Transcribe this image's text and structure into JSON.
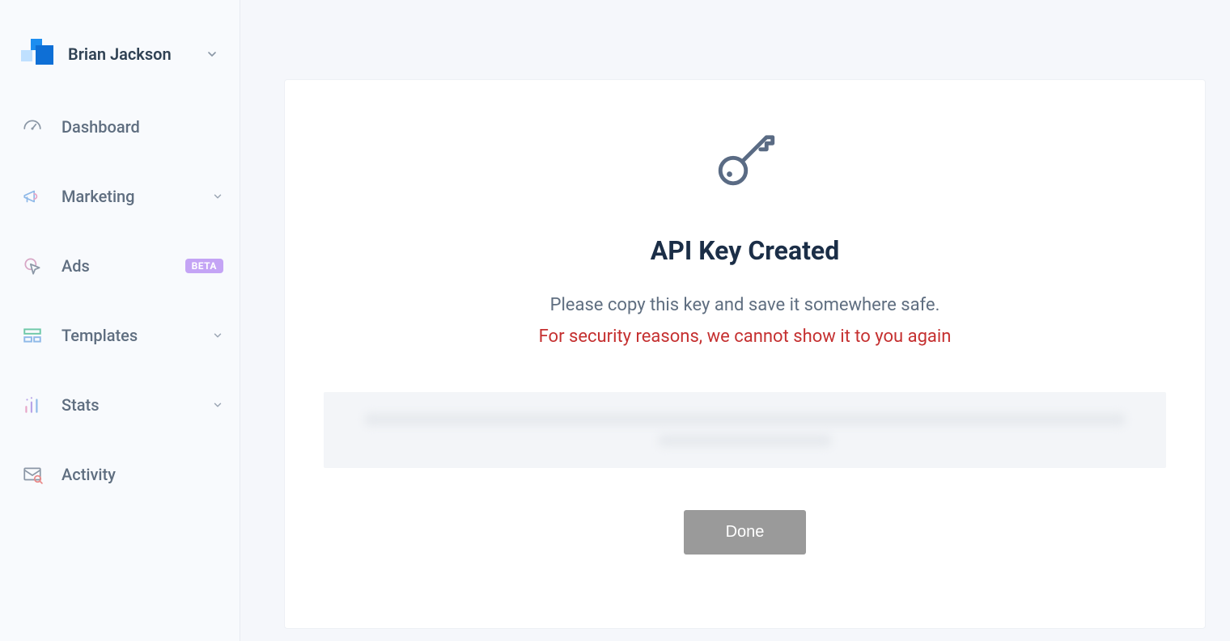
{
  "account": {
    "display_name": "Brian Jackson"
  },
  "sidebar": {
    "items": [
      {
        "icon": "gauge-icon",
        "label": "Dashboard",
        "expandable": false,
        "badge": null
      },
      {
        "icon": "megaphone-icon",
        "label": "Marketing",
        "expandable": true,
        "badge": null
      },
      {
        "icon": "cursor-icon",
        "label": "Ads",
        "expandable": false,
        "badge": "BETA"
      },
      {
        "icon": "templates-icon",
        "label": "Templates",
        "expandable": true,
        "badge": null
      },
      {
        "icon": "stats-icon",
        "label": "Stats",
        "expandable": true,
        "badge": null
      },
      {
        "icon": "activity-icon",
        "label": "Activity",
        "expandable": false,
        "badge": null
      }
    ]
  },
  "main": {
    "title": "API Key Created",
    "instruction_text": "Please copy this key and save it somewhere safe.",
    "warning_text": "For security reasons, we cannot show it to you again",
    "api_key_value": "[redacted in screenshot]",
    "done_button_label": "Done"
  }
}
